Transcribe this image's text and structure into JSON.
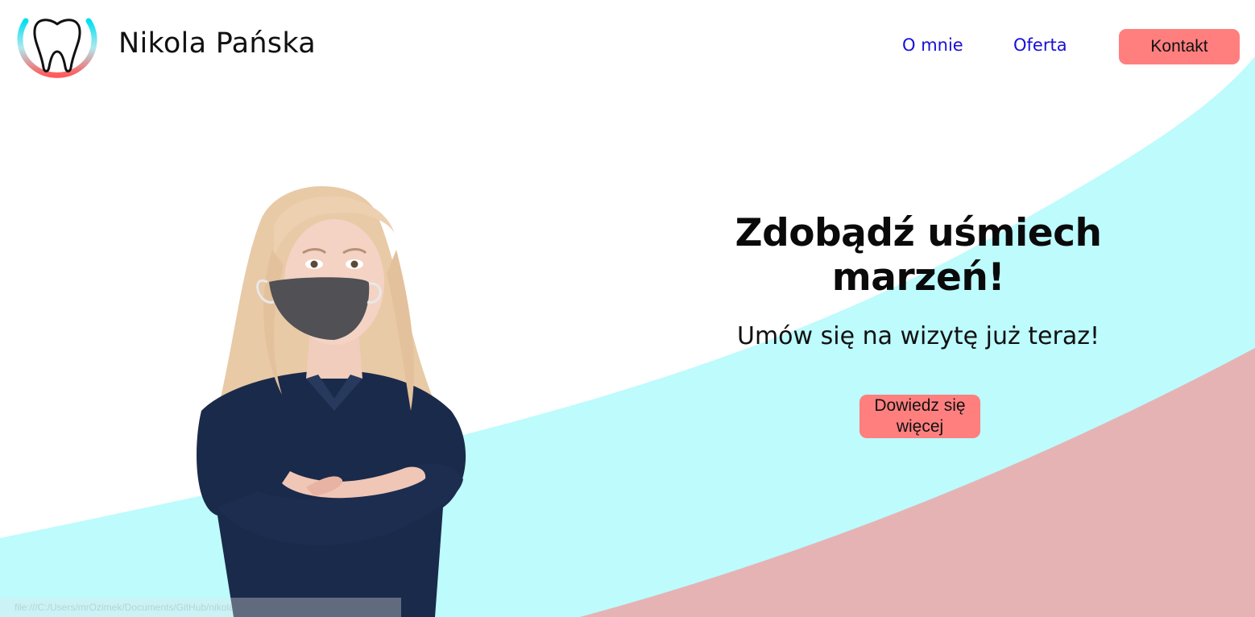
{
  "header": {
    "brand_name": "Nikola Pańska",
    "logo_icon": "tooth-logo-icon",
    "nav": {
      "about_label": "O mnie",
      "offer_label": "Oferta",
      "contact_label": "Kontakt"
    }
  },
  "hero": {
    "title": "Zdobądź uśmiech marzeń!",
    "subtitle": "Umów się na wizytę już teraz!",
    "cta_label_line1": "Dowiedz się",
    "cta_label_line2": "więcej",
    "photo": "dentist-portrait-image"
  },
  "status_bar": {
    "url": "file:///C:/Users/mrOzimek/Documents/GitHub/nikola"
  },
  "colors": {
    "accent": "#ff7f7f",
    "nav_link": "#1a0fd6",
    "wave_cyan": "#bdfbfd",
    "wave_pink": "#e6b3b4",
    "logo_gradient_top": "#00e0f0",
    "logo_gradient_bottom": "#ff5a5a"
  }
}
